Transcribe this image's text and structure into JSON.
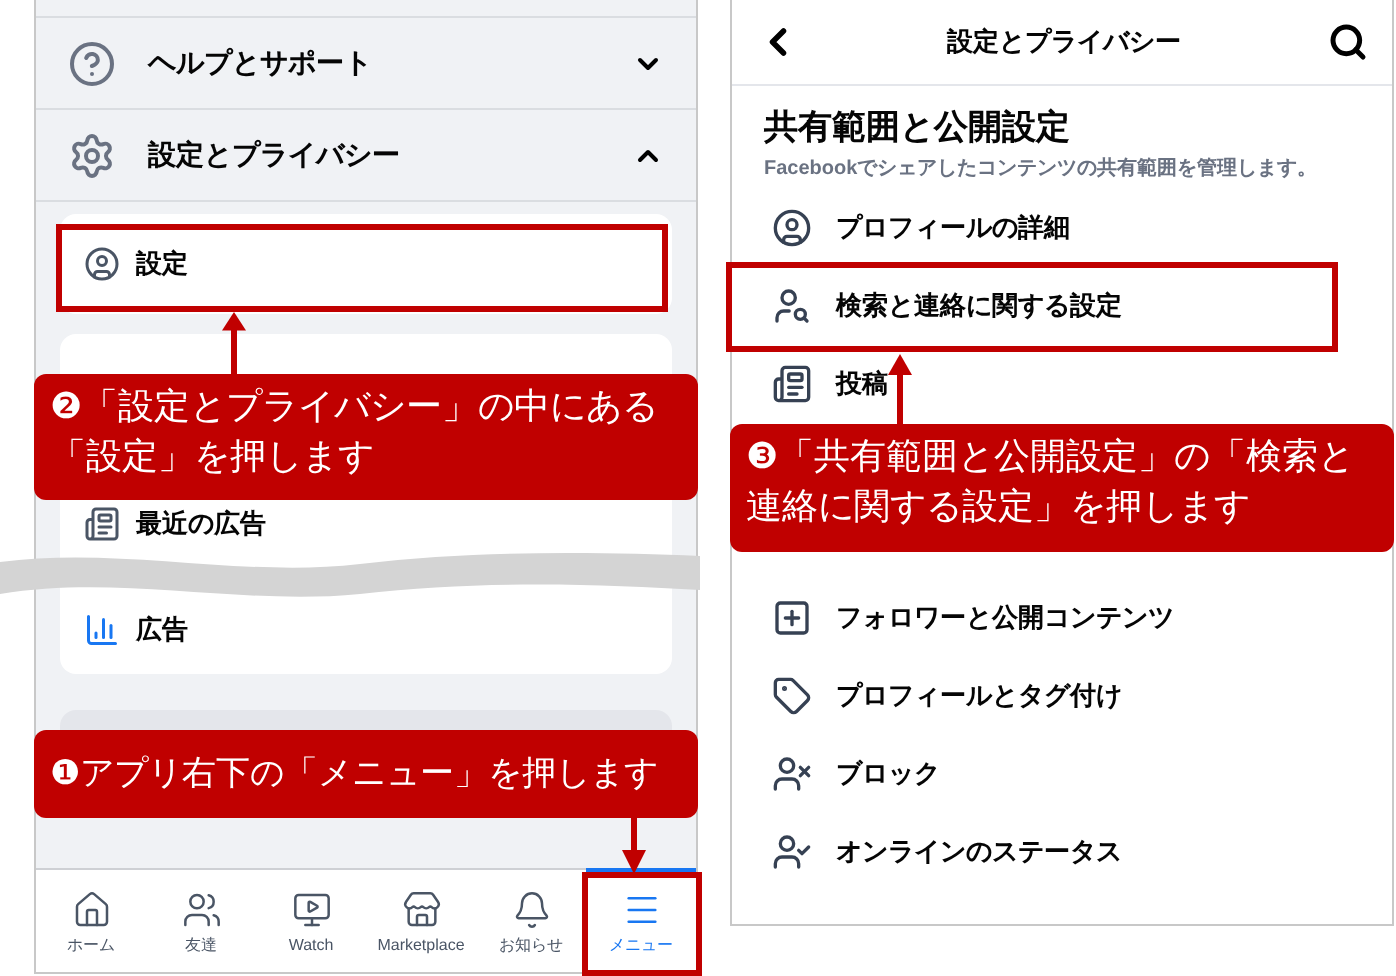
{
  "left_screen": {
    "menu_sections": [
      {
        "label": "ヘルプとサポート",
        "expanded": false
      },
      {
        "label": "設定とプライバシー",
        "expanded": true
      }
    ],
    "items": [
      {
        "label": "設定"
      },
      {
        "label": "最近の広告"
      },
      {
        "label": "広告"
      }
    ],
    "tabs": [
      {
        "label": "ホーム",
        "selected": false
      },
      {
        "label": "友達",
        "selected": false
      },
      {
        "label": "Watch",
        "selected": false
      },
      {
        "label": "Marketplace",
        "selected": false
      },
      {
        "label": "お知らせ",
        "selected": false
      },
      {
        "label": "メニュー",
        "selected": true
      }
    ]
  },
  "right_screen": {
    "title": "設定とプライバシー",
    "section_title": "共有範囲と公開設定",
    "section_subtitle": "Facebookでシェアしたコンテンツの共有範囲を管理します。",
    "items": [
      {
        "label": "プロフィールの詳細"
      },
      {
        "label": "検索と連絡に関する設定"
      },
      {
        "label": "投稿"
      },
      {
        "label": "フォロワーと公開コンテンツ"
      },
      {
        "label": "プロフィールとタグ付け"
      },
      {
        "label": "ブロック"
      },
      {
        "label": "オンラインのステータス"
      }
    ]
  },
  "callouts": [
    {
      "text": "❷「設定とプライバシー」の中にある「設定」を押します"
    },
    {
      "text": "❶アプリ右下の「メニュー」を押します"
    },
    {
      "text": "❸「共有範囲と公開設定」の「検索と連絡に関する設定」を押します"
    }
  ]
}
